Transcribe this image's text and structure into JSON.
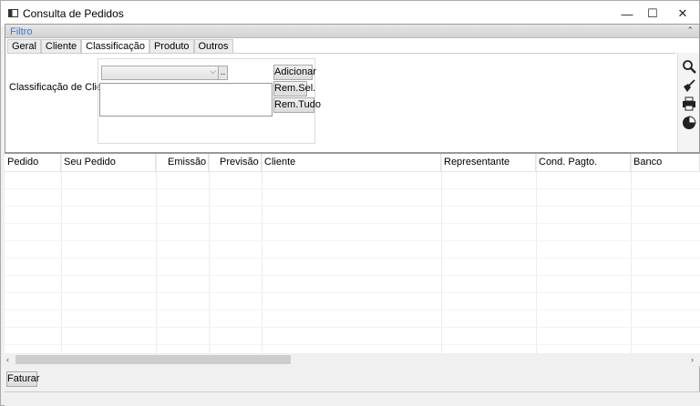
{
  "window": {
    "title": "Consulta de Pedidos",
    "minimize": "—",
    "maximize": "☐",
    "close": "✕"
  },
  "filter": {
    "title": "Filtro",
    "collapse": "⌃",
    "tabs": [
      {
        "label": "Geral"
      },
      {
        "label": "Cliente"
      },
      {
        "label": "Classificação"
      },
      {
        "label": "Produto"
      },
      {
        "label": "Outros"
      }
    ],
    "active_tab": "Classificação",
    "classificacao": {
      "label": "Classificação de Cliente",
      "combo_value": "",
      "dots_label": "..",
      "add_label": "Adicionar",
      "rem_sel_label": "Rem.Sel.",
      "rem_all_label": "Rem.Tudo"
    },
    "tools": [
      "search-icon",
      "broom-icon",
      "printer-icon",
      "pie-chart-icon"
    ]
  },
  "grid": {
    "columns": [
      {
        "label": "Pedido"
      },
      {
        "label": "Seu Pedido"
      },
      {
        "label": "Emissão"
      },
      {
        "label": "Previsão"
      },
      {
        "label": "Cliente"
      },
      {
        "label": "Representante"
      },
      {
        "label": "Cond. Pagto."
      },
      {
        "label": "Banco"
      }
    ],
    "rows": []
  },
  "scroll": {
    "left": "‹",
    "right": "›"
  },
  "footer": {
    "faturar_label": "Faturar"
  }
}
